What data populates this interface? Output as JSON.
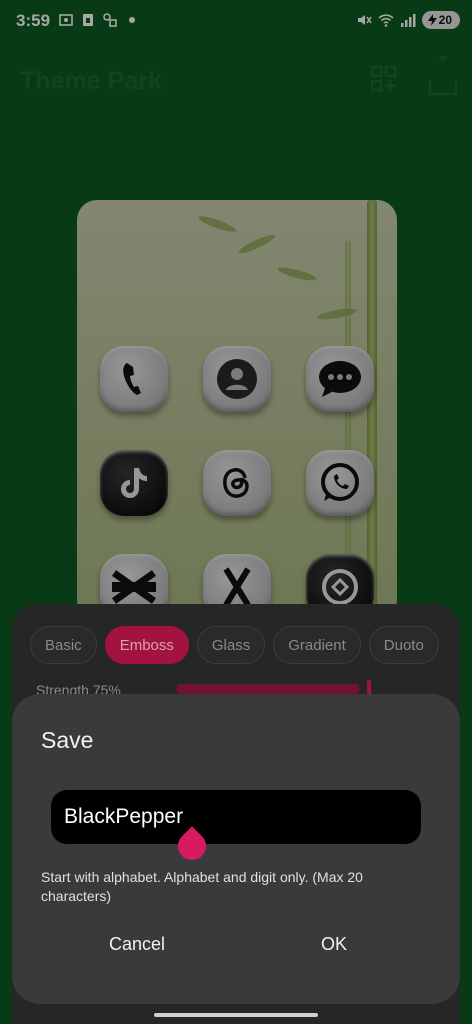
{
  "status_bar": {
    "time": "3:59",
    "battery": "20",
    "icons": [
      "screenshot-icon",
      "sim-icon",
      "link-icon",
      "dot-icon",
      "mute-icon",
      "wifi-6e-icon",
      "signal-icon",
      "battery-charging-icon"
    ]
  },
  "header": {
    "title": "Theme Park",
    "icons": [
      "add-widget-icon",
      "download-icon"
    ]
  },
  "preview": {
    "icons": [
      "phone-icon",
      "contacts-icon",
      "messages-icon",
      "tiktok-icon",
      "threads-icon",
      "whatsapp-icon",
      "capcut-icon",
      "x-icon",
      "app-icon"
    ]
  },
  "style_tabs": {
    "items": [
      "Basic",
      "Emboss",
      "Glass",
      "Gradient",
      "Duoto"
    ],
    "selected": "Emboss"
  },
  "strength": {
    "label": "Strength 75%"
  },
  "dialog": {
    "title": "Save",
    "input_value": "BlackPepper",
    "hint": "Start with alphabet. Alphabet and digit only. (Max 20 characters)",
    "cancel_label": "Cancel",
    "ok_label": "OK"
  },
  "colors": {
    "background": "#0e5a23",
    "accent": "#a2143f",
    "caret": "#d81b60",
    "dialog": "#3a3a3a"
  }
}
